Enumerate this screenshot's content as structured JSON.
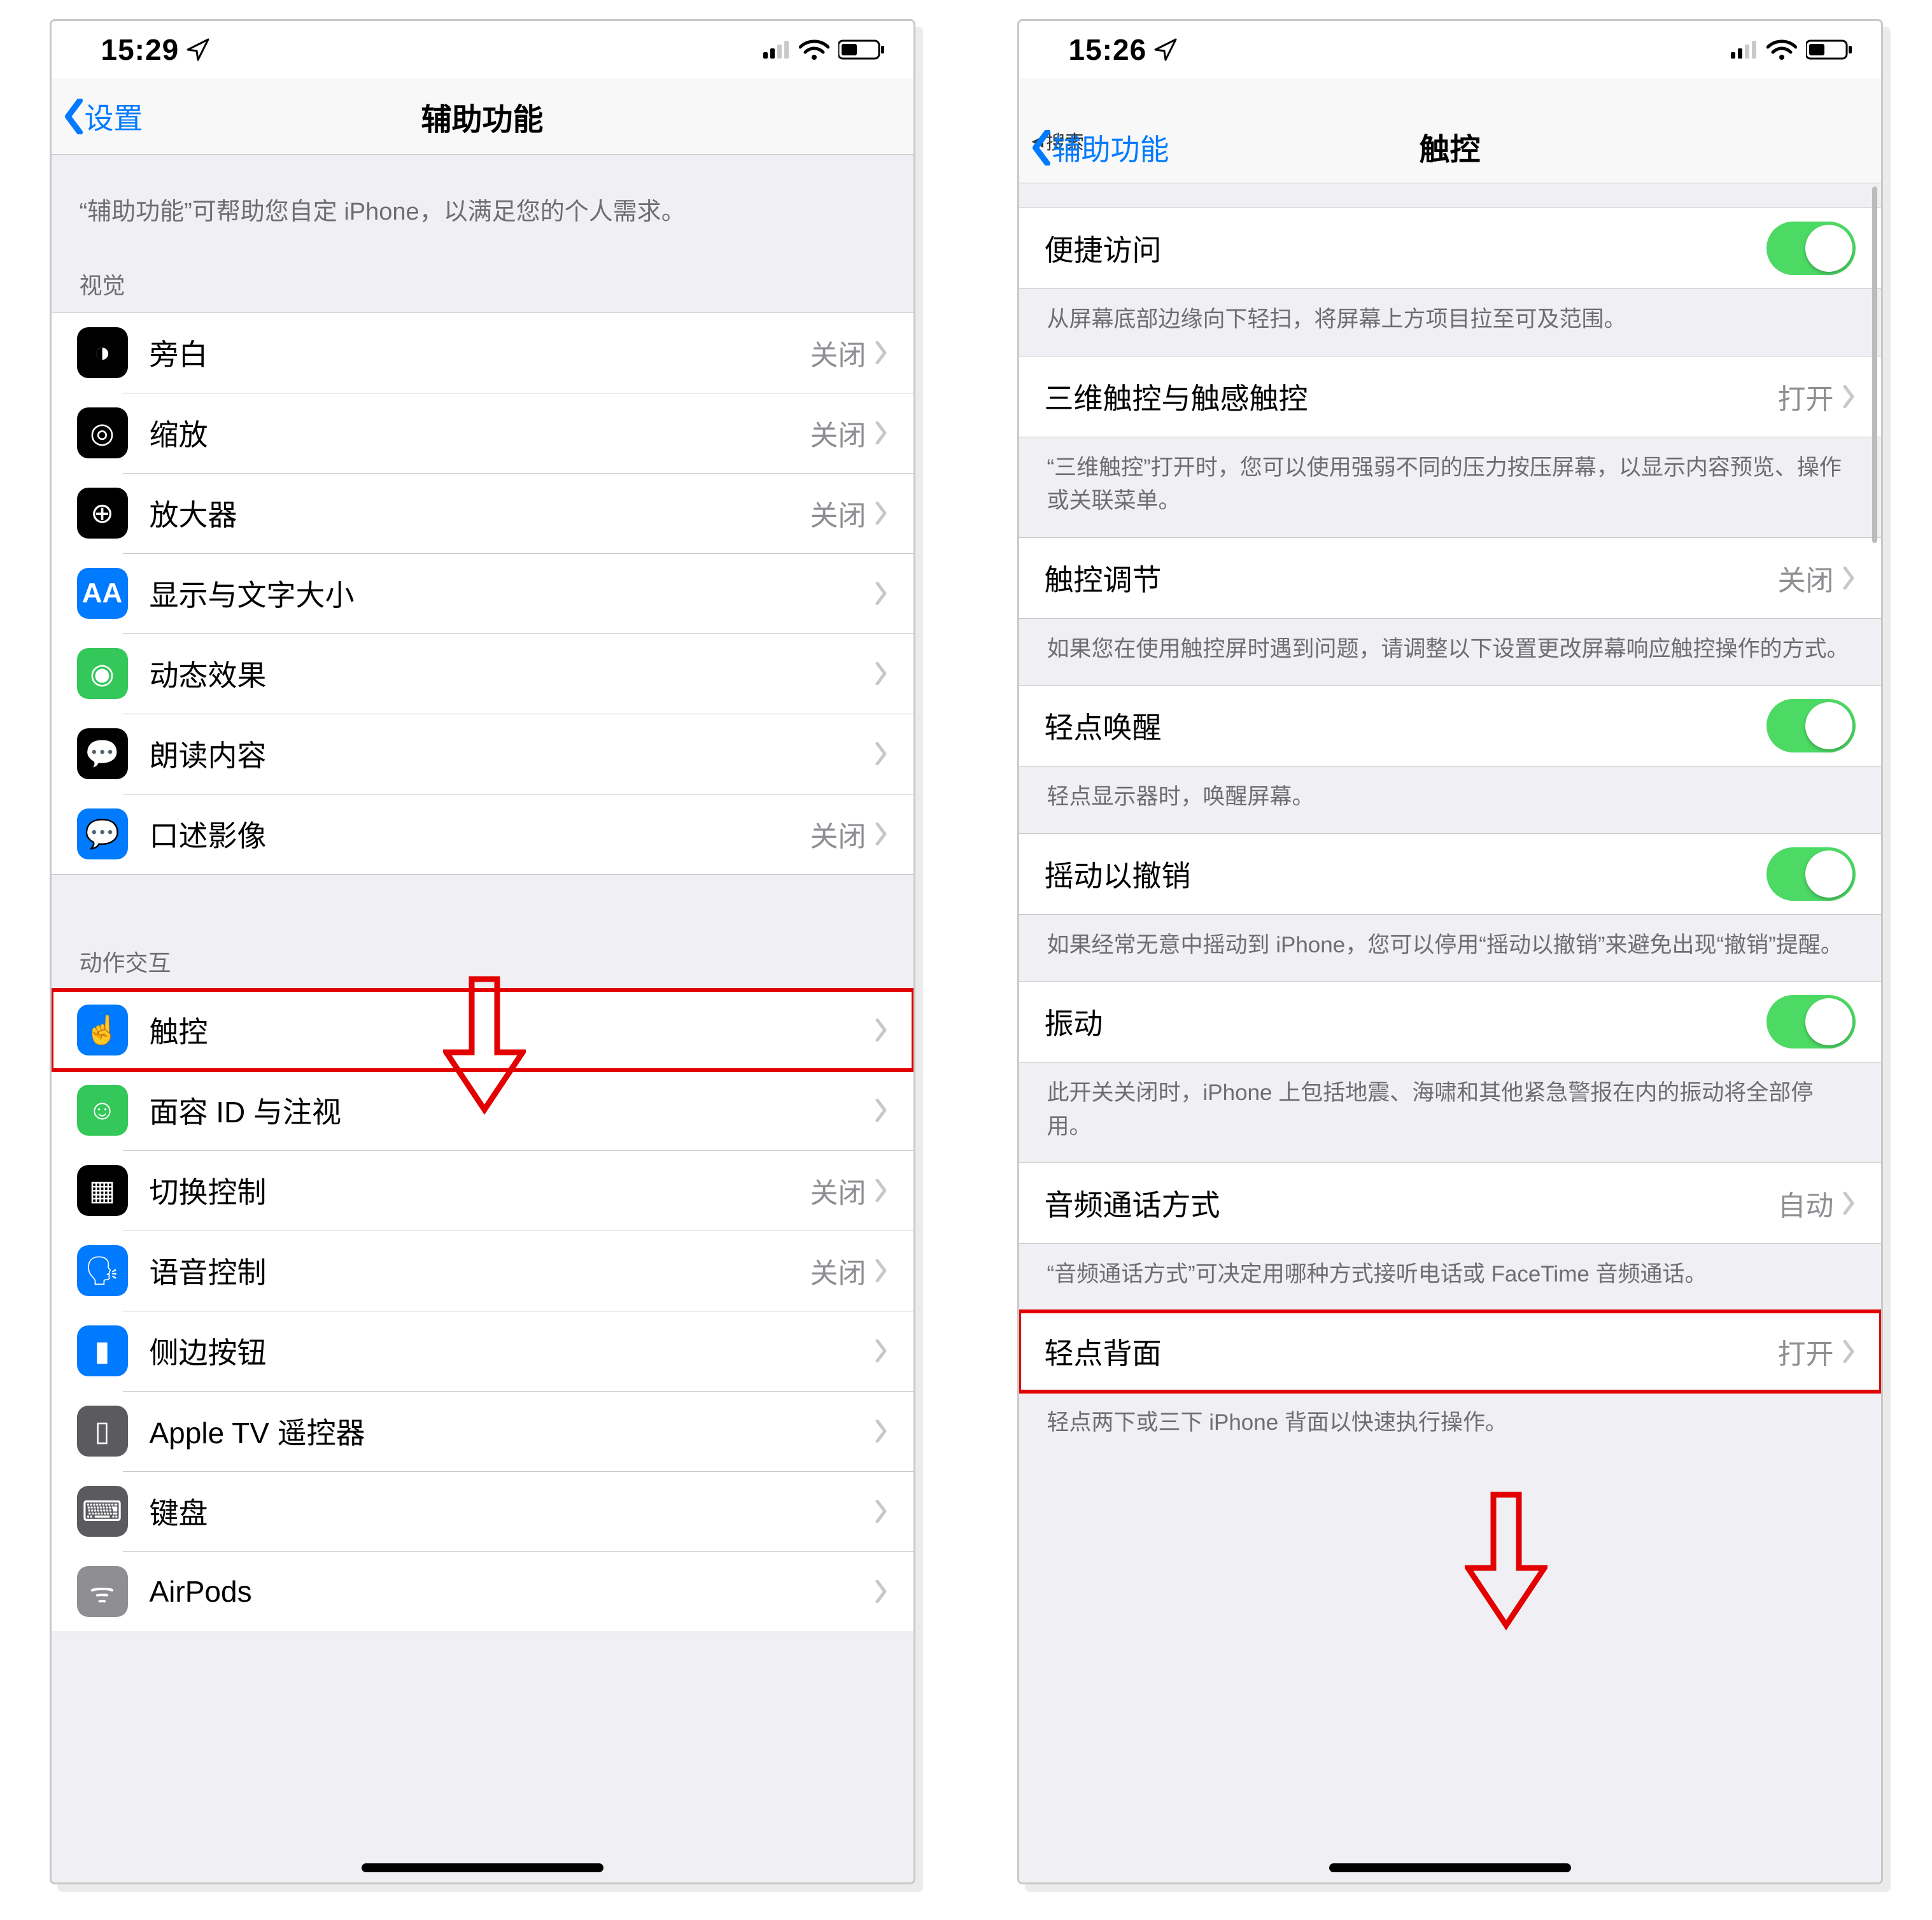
{
  "left": {
    "status_time": "15:29",
    "nav_back": "设置",
    "nav_title": "辅助功能",
    "intro": "“辅助功能”可帮助您自定 iPhone，以满足您的个人需求。",
    "group_vision": "视觉",
    "group_motor": "动作交互",
    "val_off": "关闭",
    "rows_vision": {
      "voiceover": "旁白",
      "zoom": "缩放",
      "magnifier": "放大器",
      "display": "显示与文字大小",
      "motion": "动态效果",
      "spoken": "朗读内容",
      "audiodesc": "口述影像"
    },
    "rows_motor": {
      "touch": "触控",
      "faceid": "面容 ID 与注视",
      "switch": "切换控制",
      "voicectrl": "语音控制",
      "sidebtn": "侧边按钮",
      "appletv": "Apple TV 遥控器",
      "keyboard": "键盘",
      "airpods": "AirPods"
    }
  },
  "right": {
    "status_time": "15:26",
    "sub_back": "搜索",
    "nav_back": "辅助功能",
    "nav_title": "触控",
    "val_on": "打开",
    "val_off": "关闭",
    "val_auto": "自动",
    "rows": {
      "reachability": "便捷访问",
      "reachability_foot": "从屏幕底部边缘向下轻扫，将屏幕上方项目拉至可及范围。",
      "threeD": "三维触控与触感触控",
      "threeD_foot": "“三维触控”打开时，您可以使用强弱不同的压力按压屏幕，以显示内容预览、操作或关联菜单。",
      "accom": "触控调节",
      "accom_foot": "如果您在使用触控屏时遇到问题，请调整以下设置更改屏幕响应触控操作的方式。",
      "tapwake": "轻点唤醒",
      "tapwake_foot": "轻点显示器时，唤醒屏幕。",
      "shake": "摇动以撤销",
      "shake_foot": "如果经常无意中摇动到 iPhone，您可以停用“摇动以撤销”来避免出现“撤销”提醒。",
      "vibration": "振动",
      "vibration_foot": "此开关关闭时，iPhone 上包括地震、海啸和其他紧急警报在内的振动将全部停用。",
      "callaudio": "音频通话方式",
      "callaudio_foot": "“音频通话方式”可决定用哪种方式接听电话或 FaceTime 音频通话。",
      "backtap": "轻点背面",
      "backtap_foot": "轻点两下或三下 iPhone 背面以快速执行操作。"
    }
  }
}
